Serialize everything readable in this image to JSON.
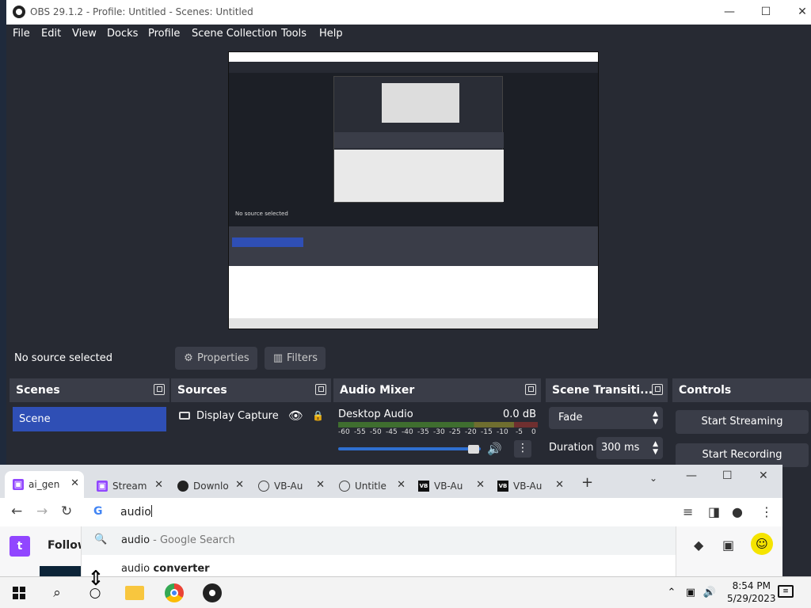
{
  "obs": {
    "title": "OBS 29.1.2 - Profile: Untitled - Scenes: Untitled",
    "menu": [
      "File",
      "Edit",
      "View",
      "Docks",
      "Profile",
      "Scene Collection",
      "Tools",
      "Help"
    ],
    "status": "No source selected",
    "properties_label": "Properties",
    "filters_label": "Filters",
    "docks": {
      "scenes": {
        "title": "Scenes",
        "items": [
          "Scene"
        ]
      },
      "sources": {
        "title": "Sources",
        "items": [
          "Display Capture"
        ]
      },
      "mixer": {
        "title": "Audio Mixer",
        "channel": "Desktop Audio",
        "level": "0.0 dB",
        "ticks": [
          "-60",
          "-55",
          "-50",
          "-45",
          "-40",
          "-35",
          "-30",
          "-25",
          "-20",
          "-15",
          "-10",
          "-5",
          "0"
        ]
      },
      "transitions": {
        "title": "Scene Transiti...",
        "selected": "Fade",
        "duration_label": "Duration",
        "duration_value": "300 ms"
      },
      "controls": {
        "title": "Controls",
        "buttons": [
          "Start Streaming",
          "Start Recording"
        ]
      }
    }
  },
  "chrome": {
    "tabs": [
      {
        "label": "ai_gen",
        "favicon": "twitch",
        "active": true
      },
      {
        "label": "Stream",
        "favicon": "twitch",
        "active": false
      },
      {
        "label": "Downlo",
        "favicon": "obs",
        "active": false
      },
      {
        "label": "VB-Au",
        "favicon": "globe",
        "active": false
      },
      {
        "label": "Untitle",
        "favicon": "globe",
        "active": false
      },
      {
        "label": "VB-Au",
        "favicon": "vb",
        "active": false
      },
      {
        "label": "VB-Au",
        "favicon": "vb",
        "active": false
      }
    ],
    "omnibox_value": "audio",
    "suggestions": [
      {
        "main": "audio",
        "suffix": " - Google Search"
      },
      {
        "main": "audio",
        "bold": " converter"
      }
    ],
    "page_left_text": "Follow"
  },
  "taskbar": {
    "time": "8:54 PM",
    "date": "5/29/2023",
    "apps": [
      "search-icon",
      "task-view-icon",
      "file-explorer-icon",
      "chrome-icon",
      "obs-icon"
    ]
  }
}
